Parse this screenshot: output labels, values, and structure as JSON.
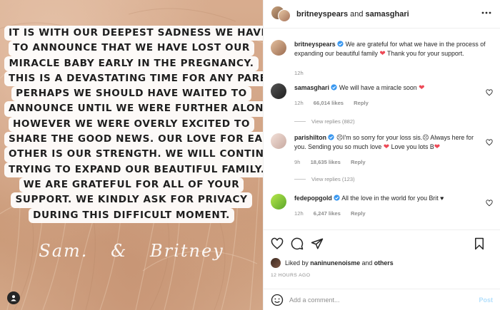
{
  "post_image": {
    "lines": [
      "IT IS WITH OUR DEEPEST SADNESS WE HAVE",
      "TO ANNOUNCE THAT WE HAVE LOST OUR",
      "MIRACLE BABY EARLY IN THE PREGNANCY.",
      "THIS IS A DEVASTATING TIME FOR ANY PARENT.",
      "PERHAPS WE SHOULD HAVE WAITED TO",
      "ANNOUNCE UNTIL WE WERE FURTHER ALONG",
      "HOWEVER WE WERE OVERLY EXCITED TO",
      "SHARE THE GOOD NEWS. OUR LOVE FOR EACH",
      "OTHER IS OUR STRENGTH. WE WILL CONTINUE",
      "TRYING TO EXPAND OUR BEAUTIFUL FAMILY.",
      "WE ARE GRATEFUL FOR ALL OF YOUR",
      "SUPPORT.  WE KINDLY ASK FOR PRIVACY",
      "DURING THIS DIFFICULT MOMENT."
    ],
    "signature": "Sam. & Britney",
    "tag_icon": "user-tag-icon"
  },
  "header": {
    "author": "britneyspears",
    "joiner": "and",
    "collaborator": "samasghari",
    "more_icon": "ellipsis-icon"
  },
  "caption": {
    "username": "britneyspears",
    "text_a": "We are grateful for what we have in the process of expanding our beautiful family",
    "text_b": "Thank you for your support.",
    "time": "12h",
    "verified_icon": "verified-badge-icon"
  },
  "comments": [
    {
      "username": "samasghari",
      "text": "We will have a miracle soon",
      "time": "12h",
      "likes": "66,014 likes",
      "reply": "Reply",
      "view_replies": "View replies (882)"
    },
    {
      "username": "parishilton",
      "text_a": "I'm so sorry for your loss sis.",
      "text_b": "Always here for you. Sending you so much love",
      "text_c": "Love you lots B",
      "time": "9h",
      "likes": "18,635 likes",
      "reply": "Reply",
      "view_replies": "View replies (123)"
    },
    {
      "username": "fedepopgold",
      "text": "All the love in the world for you Brit ♥",
      "time": "12h",
      "likes": "6,247 likes",
      "reply": "Reply"
    }
  ],
  "actions": {
    "like_icon": "heart-outline-icon",
    "comment_icon": "comment-icon",
    "share_icon": "paper-plane-icon",
    "save_icon": "bookmark-icon"
  },
  "liked_by": {
    "prefix": "Liked by",
    "user": "naninunenoisme",
    "suffix": "and",
    "others": "others"
  },
  "timestamp": "12 HOURS AGO",
  "add_comment": {
    "placeholder": "Add a comment...",
    "post_label": "Post",
    "emoji_icon": "smiley-icon"
  },
  "colors": {
    "heart": "#ed4956",
    "verified": "#3897f0",
    "post_disabled": "#b2dffc"
  }
}
